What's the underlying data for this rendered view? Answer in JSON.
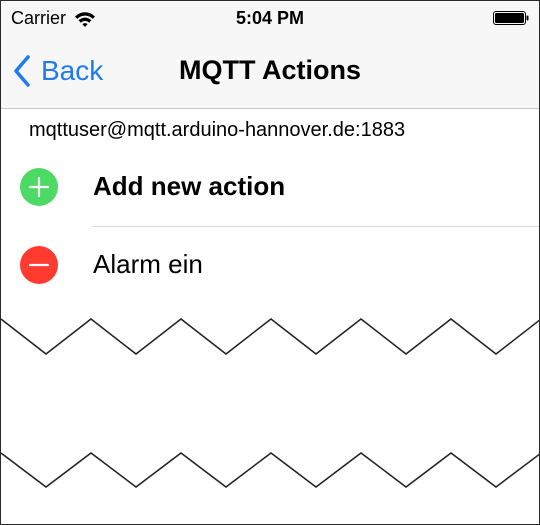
{
  "statusbar": {
    "carrier": "Carrier",
    "time": "5:04 PM",
    "icons": [
      "wifi-icon",
      "battery-icon"
    ]
  },
  "navbar": {
    "back_label": "Back",
    "title": "MQTT Actions"
  },
  "server": "mqttuser@mqtt.arduino-hannover.de:1883",
  "rows": [
    {
      "label": "Add new action",
      "icon": "add-circle-icon",
      "color": "#4cd964"
    },
    {
      "label": "Alarm ein",
      "icon": "delete-circle-icon",
      "color": "#ff3b30"
    }
  ],
  "colors": {
    "accent": "#1f7bf4",
    "bar_background": "#f7f7f7"
  }
}
